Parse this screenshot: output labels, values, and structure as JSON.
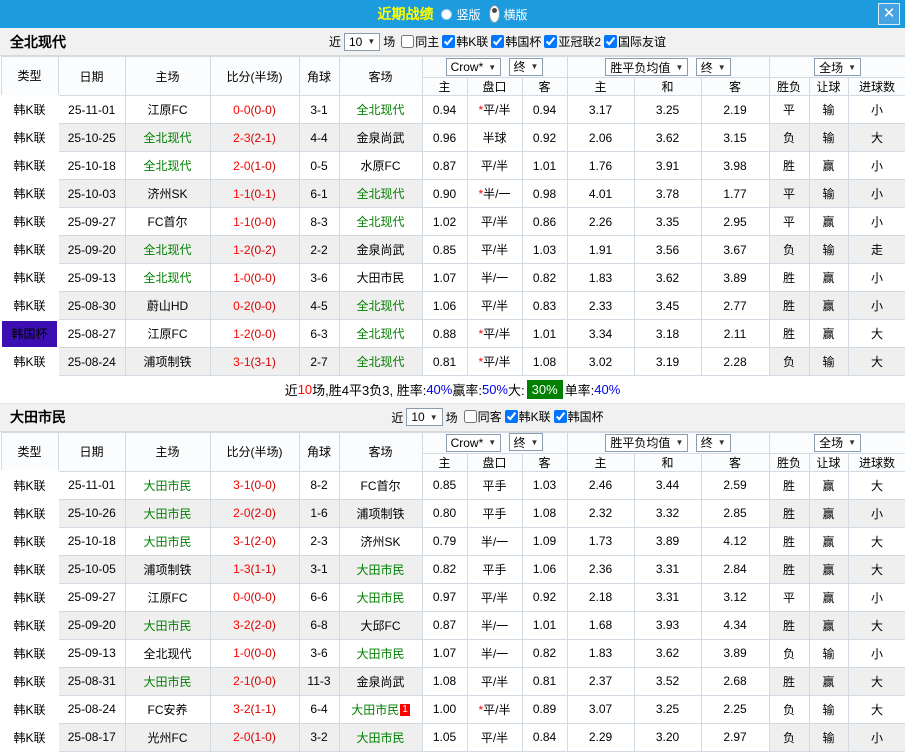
{
  "window": {
    "title": "近期战绩",
    "radio_vertical": "竖版",
    "radio_horizontal": "横版",
    "close": "✕"
  },
  "labels": {
    "near": "近",
    "games": "场"
  },
  "misc": {
    "star": "*"
  },
  "colors": {
    "topbar_blue": "#1d9bdf",
    "title_yellow": "#ffff00",
    "league_badge_blue": "#1353bb",
    "cup_badge_purple": "#3c0fb3",
    "team_highlight_green": "#008000",
    "score_red": "#ff0000",
    "win_red": "#ff0000",
    "loss_green": "#008000",
    "draw_blue": "#0000ee",
    "asia_tint": "#fbf2ee",
    "avg_tint": "#e8f2fa",
    "stripe_gray": "#efefef",
    "big_badge_green": "#008000"
  },
  "cols": {
    "type": "类型",
    "date": "日期",
    "home": "主场",
    "score": "比分(半场)",
    "corner": "角球",
    "away": "客场",
    "bookmaker": "Crow*",
    "final1": "终",
    "h1": "主",
    "hcp": "盘口",
    "h2": "客",
    "avg": "胜平负均值",
    "final2": "终",
    "a1": "主",
    "a2": "和",
    "a3": "客",
    "scope": "全场",
    "res": "胜负",
    "let": "让球",
    "goals": "进球数"
  },
  "sections": [
    {
      "team": "全北现代",
      "filter": {
        "count": "10",
        "items": [
          {
            "label": "同主",
            "checked": false
          },
          {
            "label": "韩K联",
            "checked": true
          },
          {
            "label": "韩国杯",
            "checked": true
          },
          {
            "label": "亚冠联2",
            "checked": true
          },
          {
            "label": "国际友谊",
            "checked": true
          }
        ]
      },
      "rows": [
        {
          "lg": "韩K联",
          "cup": false,
          "date": "25-11-01",
          "home": "江原FC",
          "hh": false,
          "ft": "0-0",
          "ht": "(0-0)",
          "cn": "3-1",
          "away": "全北现代",
          "ah": true,
          "ab": "",
          "o1": "0.94",
          "st": true,
          "hc": "平/半",
          "o2": "0.94",
          "m1": "3.17",
          "m2": "3.25",
          "m3": "2.19",
          "r1": "平",
          "c1": "b",
          "r2": "输",
          "c2": "g",
          "r3": "小",
          "c3": "g"
        },
        {
          "lg": "韩K联",
          "cup": false,
          "date": "25-10-25",
          "home": "全北现代",
          "hh": true,
          "ft": "2-3",
          "ht": "(2-1)",
          "cn": "4-4",
          "away": "金泉尚武",
          "ah": false,
          "ab": "",
          "o1": "0.96",
          "st": false,
          "hc": "半球",
          "o2": "0.92",
          "m1": "2.06",
          "m2": "3.62",
          "m3": "3.15",
          "r1": "负",
          "c1": "g",
          "r2": "输",
          "c2": "g",
          "r3": "大",
          "c3": "r"
        },
        {
          "lg": "韩K联",
          "cup": false,
          "date": "25-10-18",
          "home": "全北现代",
          "hh": true,
          "ft": "2-0",
          "ht": "(1-0)",
          "cn": "0-5",
          "away": "水原FC",
          "ah": false,
          "ab": "",
          "o1": "0.87",
          "st": false,
          "hc": "平/半",
          "o2": "1.01",
          "m1": "1.76",
          "m2": "3.91",
          "m3": "3.98",
          "r1": "胜",
          "c1": "r",
          "r2": "赢",
          "c2": "r",
          "r3": "小",
          "c3": "g"
        },
        {
          "lg": "韩K联",
          "cup": false,
          "date": "25-10-03",
          "home": "济州SK",
          "hh": false,
          "ft": "1-1",
          "ht": "(0-1)",
          "cn": "6-1",
          "away": "全北现代",
          "ah": true,
          "ab": "",
          "o1": "0.90",
          "st": true,
          "hc": "半/一",
          "o2": "0.98",
          "m1": "4.01",
          "m2": "3.78",
          "m3": "1.77",
          "r1": "平",
          "c1": "b",
          "r2": "输",
          "c2": "g",
          "r3": "小",
          "c3": "g"
        },
        {
          "lg": "韩K联",
          "cup": false,
          "date": "25-09-27",
          "home": "FC首尔",
          "hh": false,
          "ft": "1-1",
          "ht": "(0-0)",
          "cn": "8-3",
          "away": "全北现代",
          "ah": true,
          "ab": "",
          "o1": "1.02",
          "st": false,
          "hc": "平/半",
          "o2": "0.86",
          "m1": "2.26",
          "m2": "3.35",
          "m3": "2.95",
          "r1": "平",
          "c1": "b",
          "r2": "赢",
          "c2": "r",
          "r3": "小",
          "c3": "g"
        },
        {
          "lg": "韩K联",
          "cup": false,
          "date": "25-09-20",
          "home": "全北现代",
          "hh": true,
          "ft": "1-2",
          "ht": "(0-2)",
          "cn": "2-2",
          "away": "金泉尚武",
          "ah": false,
          "ab": "",
          "o1": "0.85",
          "st": false,
          "hc": "平/半",
          "o2": "1.03",
          "m1": "1.91",
          "m2": "3.56",
          "m3": "3.67",
          "r1": "负",
          "c1": "g",
          "r2": "输",
          "c2": "g",
          "r3": "走",
          "c3": "b"
        },
        {
          "lg": "韩K联",
          "cup": false,
          "date": "25-09-13",
          "home": "全北现代",
          "hh": true,
          "ft": "1-0",
          "ht": "(0-0)",
          "cn": "3-6",
          "away": "大田市民",
          "ah": false,
          "ab": "",
          "o1": "1.07",
          "st": false,
          "hc": "半/一",
          "o2": "0.82",
          "m1": "1.83",
          "m2": "3.62",
          "m3": "3.89",
          "r1": "胜",
          "c1": "r",
          "r2": "赢",
          "c2": "r",
          "r3": "小",
          "c3": "g"
        },
        {
          "lg": "韩K联",
          "cup": false,
          "date": "25-08-30",
          "home": "蔚山HD",
          "hh": false,
          "ft": "0-2",
          "ht": "(0-0)",
          "cn": "4-5",
          "away": "全北现代",
          "ah": true,
          "ab": "",
          "o1": "1.06",
          "st": false,
          "hc": "平/半",
          "o2": "0.83",
          "m1": "2.33",
          "m2": "3.45",
          "m3": "2.77",
          "r1": "胜",
          "c1": "r",
          "r2": "赢",
          "c2": "r",
          "r3": "小",
          "c3": "g"
        },
        {
          "lg": "韩国杯",
          "cup": true,
          "date": "25-08-27",
          "home": "江原FC",
          "hh": false,
          "ft": "1-2",
          "ht": "(0-0)",
          "cn": "6-3",
          "away": "全北现代",
          "ah": true,
          "ab": "",
          "o1": "0.88",
          "st": true,
          "hc": "平/半",
          "o2": "1.01",
          "m1": "3.34",
          "m2": "3.18",
          "m3": "2.11",
          "r1": "胜",
          "c1": "r",
          "r2": "赢",
          "c2": "r",
          "r3": "大",
          "c3": "r"
        },
        {
          "lg": "韩K联",
          "cup": false,
          "date": "25-08-24",
          "home": "浦项制铁",
          "hh": false,
          "ft": "3-1",
          "ht": "(3-1)",
          "cn": "2-7",
          "away": "全北现代",
          "ah": true,
          "ab": "",
          "o1": "0.81",
          "st": true,
          "hc": "平/半",
          "o2": "1.08",
          "m1": "3.02",
          "m2": "3.19",
          "m3": "2.28",
          "r1": "负",
          "c1": "g",
          "r2": "输",
          "c2": "g",
          "r3": "大",
          "c3": "r"
        }
      ],
      "summary": [
        {
          "t": "近",
          "c": "k"
        },
        {
          "t": "10",
          "c": "r"
        },
        {
          "t": "场,胜4平3负3, 胜率:",
          "c": "k"
        },
        {
          "t": "40%",
          "c": "b"
        },
        {
          "t": " 赢率:",
          "c": "k"
        },
        {
          "t": "50%",
          "c": "b"
        },
        {
          "t": " 大:",
          "c": "k"
        },
        {
          "t": "30%",
          "c": "badge"
        },
        {
          "t": " 单率:",
          "c": "k"
        },
        {
          "t": "40%",
          "c": "b"
        }
      ]
    },
    {
      "team": "大田市民",
      "filter": {
        "count": "10",
        "items": [
          {
            "label": "同客",
            "checked": false
          },
          {
            "label": "韩K联",
            "checked": true
          },
          {
            "label": "韩国杯",
            "checked": true
          }
        ]
      },
      "rows": [
        {
          "lg": "韩K联",
          "cup": false,
          "date": "25-11-01",
          "home": "大田市民",
          "hh": true,
          "ft": "3-1",
          "ht": "(0-0)",
          "cn": "8-2",
          "away": "FC首尔",
          "ah": false,
          "ab": "",
          "o1": "0.85",
          "st": false,
          "hc": "平手",
          "o2": "1.03",
          "m1": "2.46",
          "m2": "3.44",
          "m3": "2.59",
          "r1": "胜",
          "c1": "r",
          "r2": "赢",
          "c2": "r",
          "r3": "大",
          "c3": "r"
        },
        {
          "lg": "韩K联",
          "cup": false,
          "date": "25-10-26",
          "home": "大田市民",
          "hh": true,
          "ft": "2-0",
          "ht": "(2-0)",
          "cn": "1-6",
          "away": "浦项制铁",
          "ah": false,
          "ab": "",
          "o1": "0.80",
          "st": false,
          "hc": "平手",
          "o2": "1.08",
          "m1": "2.32",
          "m2": "3.32",
          "m3": "2.85",
          "r1": "胜",
          "c1": "r",
          "r2": "赢",
          "c2": "r",
          "r3": "小",
          "c3": "g"
        },
        {
          "lg": "韩K联",
          "cup": false,
          "date": "25-10-18",
          "home": "大田市民",
          "hh": true,
          "ft": "3-1",
          "ht": "(2-0)",
          "cn": "2-3",
          "away": "济州SK",
          "ah": false,
          "ab": "",
          "o1": "0.79",
          "st": false,
          "hc": "半/一",
          "o2": "1.09",
          "m1": "1.73",
          "m2": "3.89",
          "m3": "4.12",
          "r1": "胜",
          "c1": "r",
          "r2": "赢",
          "c2": "r",
          "r3": "大",
          "c3": "r"
        },
        {
          "lg": "韩K联",
          "cup": false,
          "date": "25-10-05",
          "home": "浦项制铁",
          "hh": false,
          "ft": "1-3",
          "ht": "(1-1)",
          "cn": "3-1",
          "away": "大田市民",
          "ah": true,
          "ab": "",
          "o1": "0.82",
          "st": false,
          "hc": "平手",
          "o2": "1.06",
          "m1": "2.36",
          "m2": "3.31",
          "m3": "2.84",
          "r1": "胜",
          "c1": "r",
          "r2": "赢",
          "c2": "r",
          "r3": "大",
          "c3": "r"
        },
        {
          "lg": "韩K联",
          "cup": false,
          "date": "25-09-27",
          "home": "江原FC",
          "hh": false,
          "ft": "0-0",
          "ht": "(0-0)",
          "cn": "6-6",
          "away": "大田市民",
          "ah": true,
          "ab": "",
          "o1": "0.97",
          "st": false,
          "hc": "平/半",
          "o2": "0.92",
          "m1": "2.18",
          "m2": "3.31",
          "m3": "3.12",
          "r1": "平",
          "c1": "b",
          "r2": "赢",
          "c2": "r",
          "r3": "小",
          "c3": "g"
        },
        {
          "lg": "韩K联",
          "cup": false,
          "date": "25-09-20",
          "home": "大田市民",
          "hh": true,
          "ft": "3-2",
          "ht": "(2-0)",
          "cn": "6-8",
          "away": "大邱FC",
          "ah": false,
          "ab": "",
          "o1": "0.87",
          "st": false,
          "hc": "半/一",
          "o2": "1.01",
          "m1": "1.68",
          "m2": "3.93",
          "m3": "4.34",
          "r1": "胜",
          "c1": "r",
          "r2": "赢",
          "c2": "r",
          "r3": "大",
          "c3": "r"
        },
        {
          "lg": "韩K联",
          "cup": false,
          "date": "25-09-13",
          "home": "全北现代",
          "hh": false,
          "ft": "1-0",
          "ht": "(0-0)",
          "cn": "3-6",
          "away": "大田市民",
          "ah": true,
          "ab": "",
          "o1": "1.07",
          "st": false,
          "hc": "半/一",
          "o2": "0.82",
          "m1": "1.83",
          "m2": "3.62",
          "m3": "3.89",
          "r1": "负",
          "c1": "g",
          "r2": "输",
          "c2": "g",
          "r3": "小",
          "c3": "g"
        },
        {
          "lg": "韩K联",
          "cup": false,
          "date": "25-08-31",
          "home": "大田市民",
          "hh": true,
          "ft": "2-1",
          "ht": "(0-0)",
          "cn": "11-3",
          "away": "金泉尚武",
          "ah": false,
          "ab": "",
          "o1": "1.08",
          "st": false,
          "hc": "平/半",
          "o2": "0.81",
          "m1": "2.37",
          "m2": "3.52",
          "m3": "2.68",
          "r1": "胜",
          "c1": "r",
          "r2": "赢",
          "c2": "r",
          "r3": "大",
          "c3": "r"
        },
        {
          "lg": "韩K联",
          "cup": false,
          "date": "25-08-24",
          "home": "FC安养",
          "hh": false,
          "ft": "3-2",
          "ht": "(1-1)",
          "cn": "6-4",
          "away": "大田市民",
          "ah": true,
          "ab": "1",
          "o1": "1.00",
          "st": true,
          "hc": "平/半",
          "o2": "0.89",
          "m1": "3.07",
          "m2": "3.25",
          "m3": "2.25",
          "r1": "负",
          "c1": "g",
          "r2": "输",
          "c2": "g",
          "r3": "大",
          "c3": "r"
        },
        {
          "lg": "韩K联",
          "cup": false,
          "date": "25-08-17",
          "home": "光州FC",
          "hh": false,
          "ft": "2-0",
          "ht": "(1-0)",
          "cn": "3-2",
          "away": "大田市民",
          "ah": true,
          "ab": "",
          "o1": "1.05",
          "st": false,
          "hc": "平/半",
          "o2": "0.84",
          "m1": "2.29",
          "m2": "3.20",
          "m3": "2.97",
          "r1": "负",
          "c1": "g",
          "r2": "输",
          "c2": "g",
          "r3": "小",
          "c3": "g"
        }
      ]
    }
  ]
}
